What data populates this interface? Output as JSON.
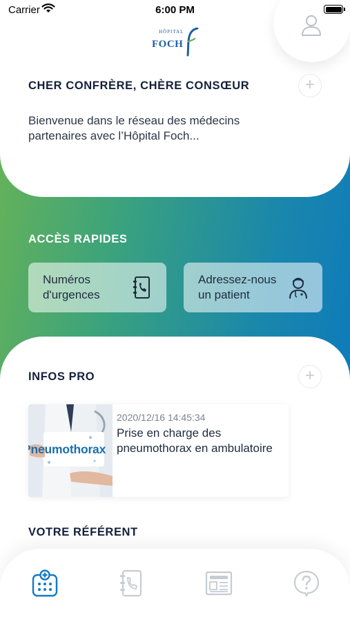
{
  "status_bar": {
    "carrier": "Carrier",
    "time": "6:00 PM"
  },
  "logo": {
    "small_text": "HÔPITAL",
    "name": "FOCH"
  },
  "welcome": {
    "title": "CHER CONFRÈRE, CHÈRE CONSŒUR",
    "text": "Bienvenue dans le réseau des médecins partenaires avec l’Hôpital Foch..."
  },
  "quick_access": {
    "title": "ACCÈS RAPIDES",
    "items": [
      {
        "label_line1": "Numéros",
        "label_line2": "d'urgences",
        "icon": "phone-book-icon"
      },
      {
        "label_line1": "Adressez-nous",
        "label_line2": "un patient",
        "icon": "doctor-icon"
      }
    ]
  },
  "infos_pro": {
    "title": "INFOS PRO",
    "articles": [
      {
        "thumb_text": "Pneumothorax",
        "date": "2020/12/16 14:45:34",
        "title": "Prise en charge des pneumothorax en ambulatoire"
      }
    ]
  },
  "referent": {
    "title": "VOTRE RÉFÉRENT"
  },
  "tab_bar": {
    "tabs": [
      {
        "name": "hospital-calendar-icon",
        "active": true
      },
      {
        "name": "phone-book-icon",
        "active": false
      },
      {
        "name": "news-icon",
        "active": false
      },
      {
        "name": "help-icon",
        "active": false
      }
    ]
  },
  "colors": {
    "gradient_start": "#6db552",
    "gradient_end": "#0b76c0",
    "active_tab": "#1479c3",
    "inactive_tab": "#c6ccd3"
  }
}
